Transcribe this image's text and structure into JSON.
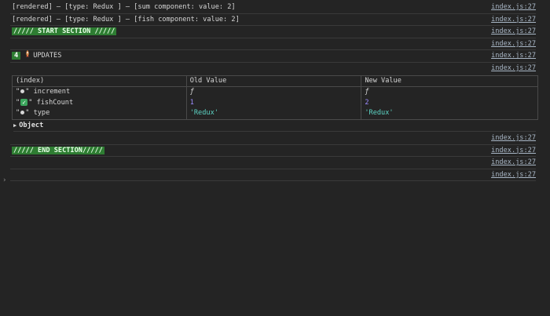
{
  "logs": [
    {
      "text": "[rendered] – [type: Redux ] – [sum component: value: 2]",
      "source": "index.js:27"
    },
    {
      "text": "[rendered] – [type: Redux ] – [fish component: value: 2]",
      "source": "index.js:27"
    }
  ],
  "start_section": {
    "label": "///// START SECTION /////",
    "source": "index.js:27"
  },
  "blank_log": {
    "source": "index.js:27"
  },
  "updates": {
    "count": "4",
    "icon": "rocket-icon",
    "label": "UPDATES",
    "source": "index.js:27"
  },
  "table_source": "index.js:27",
  "table": {
    "headers": [
      "(index)",
      "Old Value",
      "New Value"
    ],
    "rows": [
      {
        "quote_open": "\"",
        "quote_close": "\"",
        "marker": "dot",
        "key": "increment",
        "old": "ƒ",
        "new": "ƒ"
      },
      {
        "quote_open": "\"",
        "quote_close": "\"",
        "marker": "check",
        "key": "fishCount",
        "old": "1",
        "new": "2"
      },
      {
        "quote_open": "\"",
        "quote_close": "\"",
        "marker": "dot",
        "key": "type",
        "old": "'Redux'",
        "new": "'Redux'"
      }
    ]
  },
  "object_label": "Object",
  "after_object_source": "index.js:27",
  "end_section": {
    "label": "///// END SECTION/////",
    "source": "index.js:27"
  },
  "trailing_sources": [
    "index.js:27",
    "index.js:27"
  ],
  "prompt_symbol": "›",
  "colors": {
    "background": "#242424",
    "section_tag": "#2e7d32",
    "number": "#9d8cff",
    "string": "#5dd4c4",
    "check": "#3ba55c"
  }
}
